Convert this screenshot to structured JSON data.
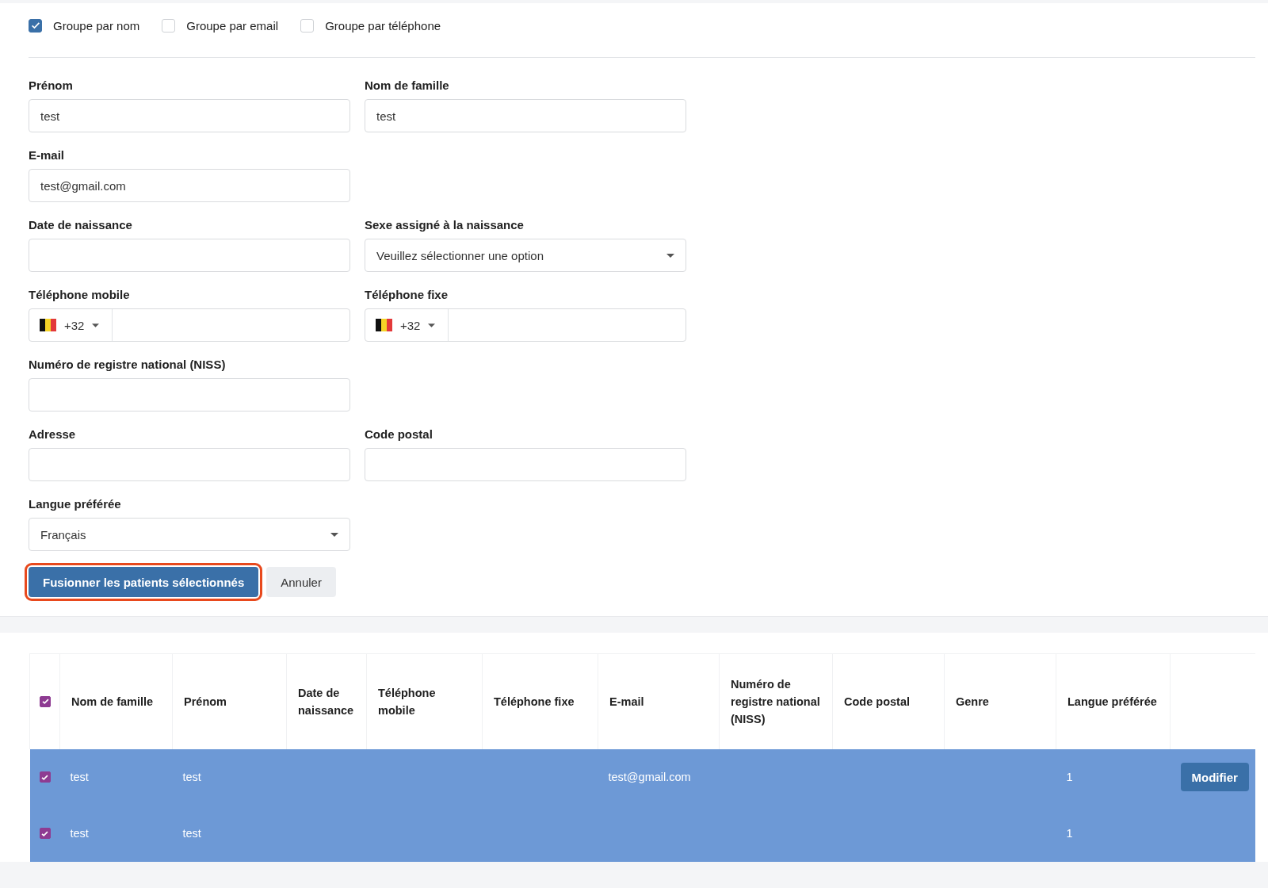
{
  "grouping": [
    {
      "label": "Groupe par nom",
      "checked": true
    },
    {
      "label": "Groupe par email",
      "checked": false
    },
    {
      "label": "Groupe par téléphone",
      "checked": false
    }
  ],
  "form": {
    "rows": [
      [
        {
          "kind": "text",
          "label": "Prénom",
          "value": "test"
        },
        {
          "kind": "text",
          "label": "Nom de famille",
          "value": "test"
        }
      ],
      [
        {
          "kind": "text",
          "label": "E-mail",
          "value": "test@gmail.com"
        }
      ],
      [
        {
          "kind": "text",
          "label": "Date de naissance"
        },
        {
          "kind": "select",
          "label": "Sexe assigné à la naissance",
          "value": "Veuillez sélectionner une option"
        }
      ],
      [
        {
          "kind": "phone",
          "label": "Téléphone mobile",
          "prefix": "+32"
        },
        {
          "kind": "phone",
          "label": "Téléphone fixe",
          "prefix": "+32"
        }
      ],
      [
        {
          "kind": "text",
          "label": "Numéro de registre national (NISS)"
        }
      ],
      [
        {
          "kind": "text",
          "label": "Adresse"
        },
        {
          "kind": "text",
          "label": "Code postal"
        }
      ],
      [
        {
          "kind": "select",
          "label": "Langue préférée",
          "value": "Français"
        }
      ]
    ]
  },
  "buttons": [
    {
      "kind": "primary",
      "label": "Fusionner les patients sélectionnés",
      "highlighted": true
    },
    {
      "kind": "secondary",
      "label": "Annuler",
      "highlighted": false
    }
  ],
  "table": {
    "select_all": {
      "checked": true
    },
    "columns": [
      "Nom de famille",
      "Prénom",
      "Date de naissance",
      "Téléphone mobile",
      "Téléphone fixe",
      "E-mail",
      "Numéro de registre national (NISS)",
      "Code postal",
      "Genre",
      "Langue préférée"
    ],
    "rows": [
      {
        "selected": true,
        "checked": true,
        "cells": [
          "test",
          "test",
          "",
          "",
          "",
          "test@gmail.com",
          "",
          "",
          "",
          "1"
        ],
        "action": "Modifier"
      },
      {
        "selected": true,
        "checked": true,
        "cells": [
          "test",
          "test",
          "",
          "",
          "",
          "",
          "",
          "",
          "",
          "1"
        ]
      }
    ]
  }
}
